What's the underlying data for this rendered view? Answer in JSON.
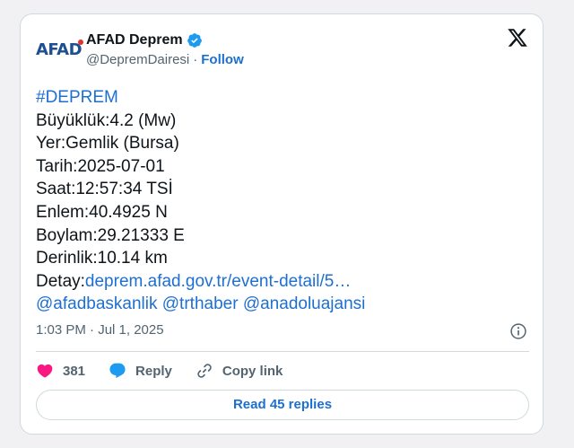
{
  "account": {
    "logo_text": "AFAD",
    "display_name": "AFAD Deprem",
    "handle": "@DepremDairesi",
    "separator": "·",
    "follow_label": "Follow"
  },
  "tweet": {
    "hashtag": "#DEPREM",
    "lines": [
      "Büyüklük:4.2 (Mw)",
      "Yer:Gemlik (Bursa)",
      "Tarih:2025-07-01",
      "Saat:12:57:34 TSİ",
      "Enlem:40.4925 N",
      "Boylam:29.21333 E",
      "Derinlik:10.14 km"
    ],
    "detail_prefix": "Detay:",
    "detail_link": "deprem.afad.gov.tr/event-detail/5…",
    "mentions": [
      "@afadbaskanlik",
      "@trthaber",
      "@anadoluajansi"
    ]
  },
  "meta": {
    "timestamp": "1:03 PM · Jul 1, 2025"
  },
  "actions": {
    "like_count": "381",
    "reply_label": "Reply",
    "copy_link_label": "Copy link"
  },
  "read_replies_label": "Read 45 replies",
  "colors": {
    "link": "#1d6fd1",
    "like": "#f91880",
    "verified": "#1d9bf0",
    "brand_logo": "#1d4f91"
  },
  "icons": [
    "verified-badge-icon",
    "x-logo-icon",
    "info-icon",
    "heart-icon",
    "reply-bubble-icon",
    "link-icon"
  ]
}
